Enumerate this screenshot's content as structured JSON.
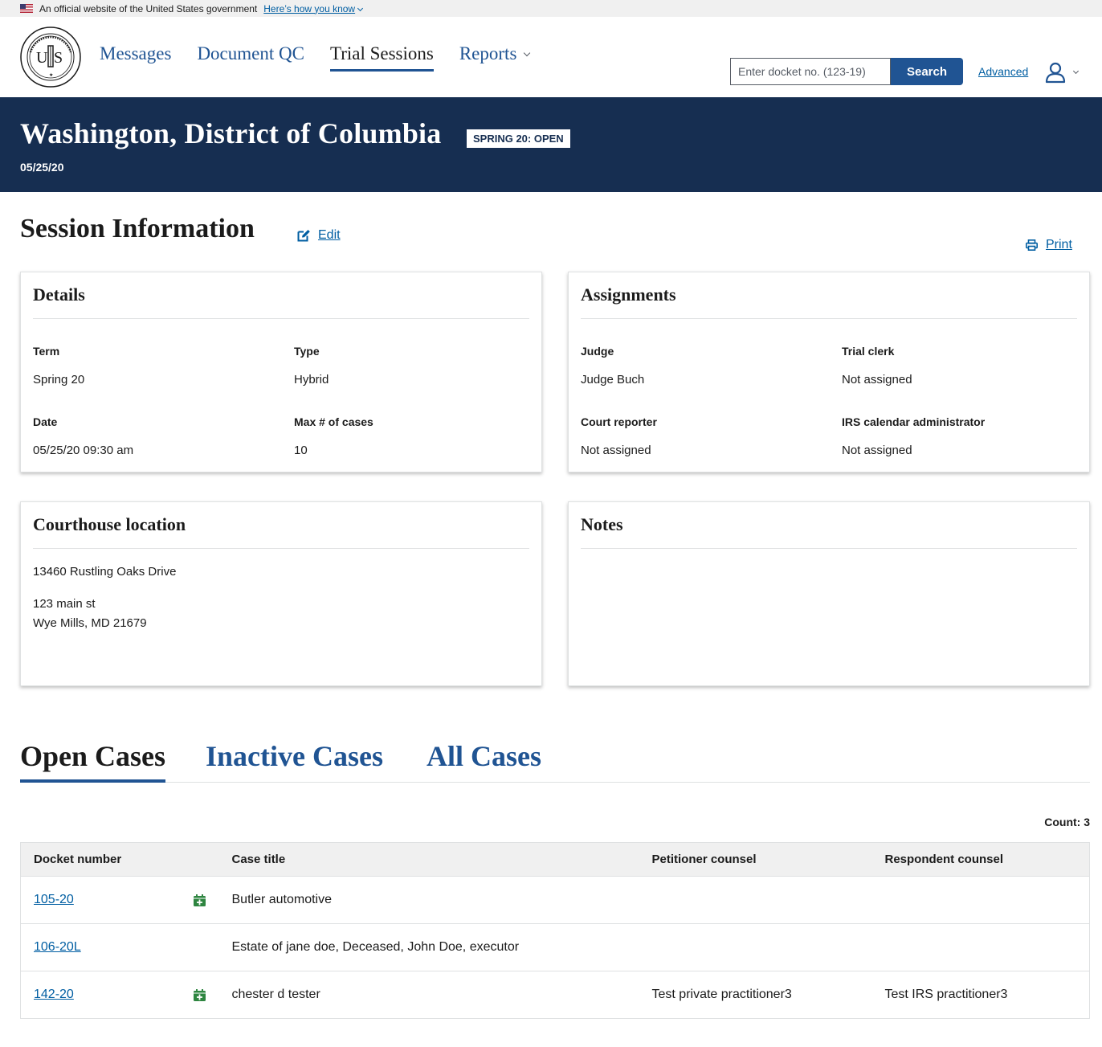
{
  "gov_banner": {
    "text": "An official website of the United States government",
    "link": "Here’s how you know"
  },
  "header": {
    "seal_text": "UNITED STATES TAX COURT",
    "nav": [
      {
        "label": "Messages"
      },
      {
        "label": "Document QC"
      },
      {
        "label": "Trial Sessions"
      },
      {
        "label": "Reports"
      }
    ],
    "search": {
      "placeholder": "Enter docket no. (123-19)",
      "button": "Search"
    },
    "advanced": "Advanced"
  },
  "hero": {
    "title": "Washington, District of Columbia",
    "tag": "SPRING 20: OPEN",
    "date": "05/25/20"
  },
  "session": {
    "title": "Session Information",
    "edit": "Edit",
    "print": "Print"
  },
  "details": {
    "title": "Details",
    "term_label": "Term",
    "term": "Spring 20",
    "type_label": "Type",
    "type": "Hybrid",
    "date_label": "Date",
    "date": "05/25/20 09:30 am",
    "max_label": "Max # of cases",
    "max": "10"
  },
  "assignments": {
    "title": "Assignments",
    "judge_label": "Judge",
    "judge": "Judge Buch",
    "clerk_label": "Trial clerk",
    "clerk": "Not assigned",
    "reporter_label": "Court reporter",
    "reporter": "Not assigned",
    "irs_label": "IRS calendar administrator",
    "irs": "Not assigned"
  },
  "courthouse": {
    "title": "Courthouse location",
    "name": "13460 Rustling Oaks Drive",
    "address1": "123 main st",
    "address2": "Wye Mills, MD 21679"
  },
  "notes": {
    "title": "Notes"
  },
  "tabs": [
    {
      "label": "Open Cases"
    },
    {
      "label": "Inactive Cases"
    },
    {
      "label": "All Cases"
    }
  ],
  "count_text": "Count: 3",
  "table": {
    "headers": [
      "Docket number",
      "Case title",
      "Petitioner counsel",
      "Respondent counsel"
    ],
    "rows": [
      {
        "docket": "105-20",
        "calendar_icon": "calendar-plus-icon",
        "title": "Butler automotive",
        "petitioner": "",
        "respondent": ""
      },
      {
        "docket": "106-20L",
        "calendar_icon": "",
        "title": "Estate of jane doe, Deceased, John Doe, executor",
        "petitioner": "",
        "respondent": ""
      },
      {
        "docket": "142-20",
        "calendar_icon": "calendar-plus-icon",
        "title": "chester d tester",
        "petitioner": "Test private practitioner3",
        "respondent": "Test IRS practitioner3"
      }
    ]
  },
  "colors": {
    "primary": "#205493",
    "hero_bg": "#162e51",
    "link": "#005ea2",
    "calendar_green": "#2e8540"
  }
}
